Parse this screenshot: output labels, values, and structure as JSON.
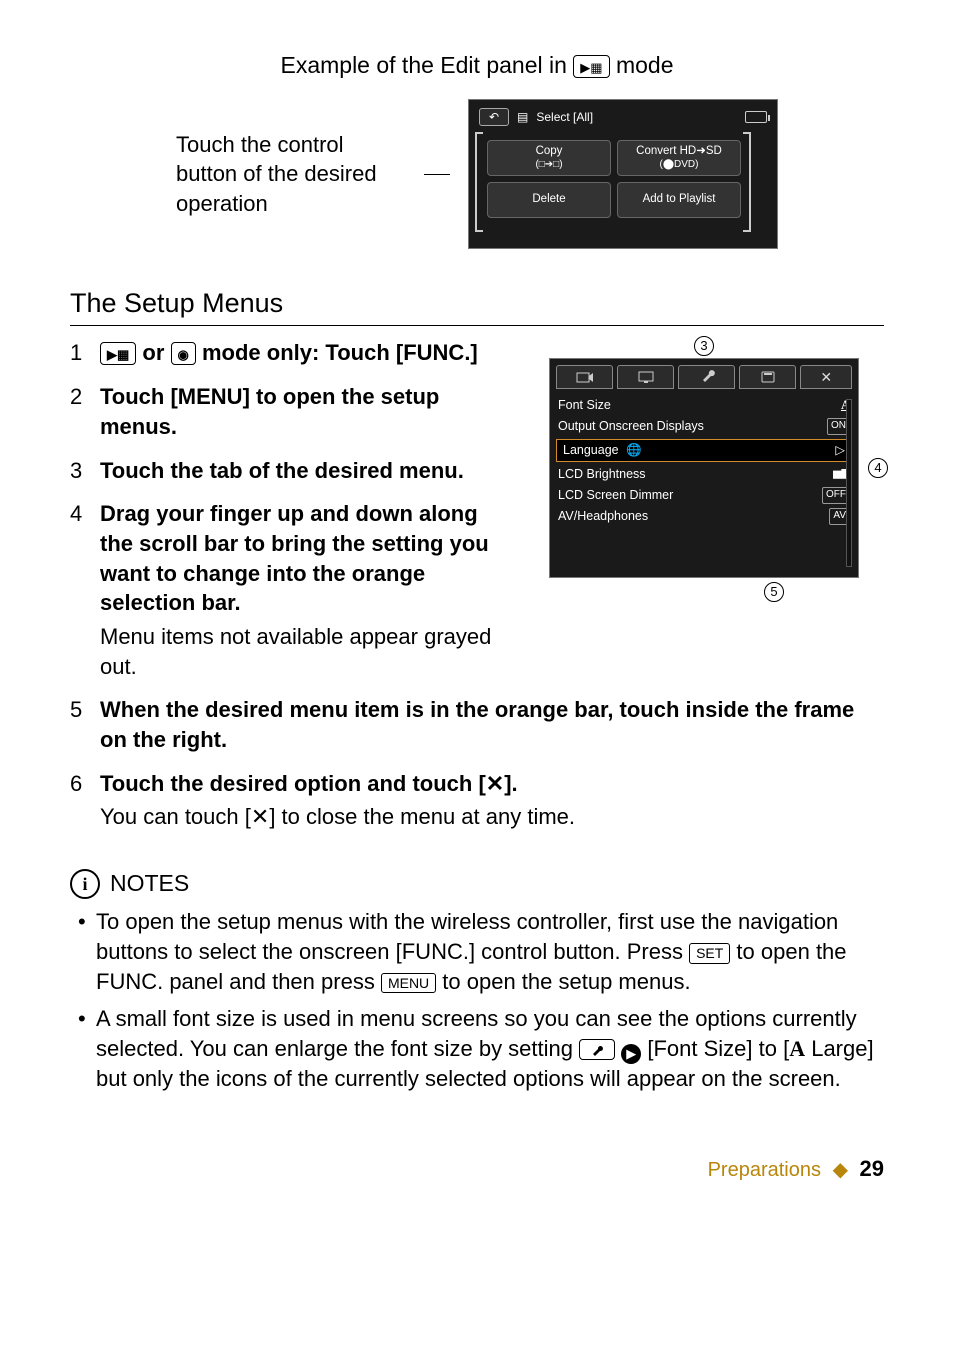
{
  "title": {
    "prefix": "Example of the Edit panel in ",
    "mode_icon": "filmstrip-play",
    "suffix": " mode"
  },
  "caption_left": "Touch the control button of the desired operation",
  "edit_panel": {
    "select_all": "Select [All]",
    "btn_copy": "Copy",
    "btn_copy_sub": "(□➔□)",
    "btn_convert": "Convert HD➜SD",
    "btn_convert_sub": "(⬤DVD)",
    "btn_delete": "Delete",
    "btn_add": "Add to Playlist"
  },
  "setup_heading": "The Setup Menus",
  "steps": {
    "s1a": " or ",
    "s1b": " mode only: Touch [FUNC.]",
    "s2": "Touch [MENU] to open the setup menus.",
    "s3": "Touch the tab of the desired menu.",
    "s4": "Drag your finger up and down along the scroll bar to bring the setting you want to change into the orange selection bar.",
    "s4_sub": "Menu items not available appear grayed out.",
    "s5": "When the desired menu item is in the orange bar, touch inside the frame on the right.",
    "s6a": "Touch the desired option and touch [",
    "s6b": "].",
    "s6_sub_a": "You can touch [",
    "s6_sub_b": "] to close the menu at any time."
  },
  "setup_panel": {
    "line1": "Font Size",
    "val1": "A",
    "line2": "Output Onscreen Displays",
    "val2": "ON",
    "sel": "Language",
    "line3": "LCD Brightness",
    "line4": "LCD Screen Dimmer",
    "val4": "OFF",
    "line5": "AV/Headphones",
    "val5": "AV"
  },
  "callouts": {
    "c3": "3",
    "c4": "4",
    "c5": "5"
  },
  "notes": {
    "label": "NOTES",
    "n1a": "To open the setup menus with the wireless controller, first use the navigation buttons to select the onscreen [FUNC.] control button. Press ",
    "key_set": "SET",
    "n1b": " to open the FUNC. panel and then press ",
    "key_menu": "MENU",
    "n1c": " to open the setup menus.",
    "n2a": "A small font size is used in menu screens so you can see the options currently selected. You can enlarge the font size by setting ",
    "n2b": " [Font Size] to [",
    "n2_large": " Large] but only the icons of the currently selected options will appear on the screen."
  },
  "footer": {
    "chapter": "Preparations",
    "page": "29"
  }
}
